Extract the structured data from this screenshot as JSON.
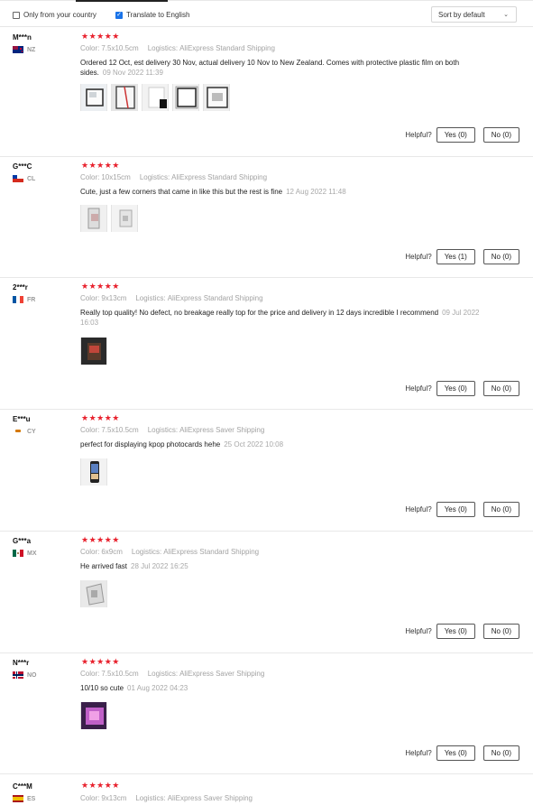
{
  "filters": {
    "only_country": {
      "label": "Only from your country",
      "checked": false
    },
    "translate": {
      "label": "Translate to English",
      "checked": true
    },
    "sort": {
      "value": "Sort by default"
    }
  },
  "labels": {
    "color_key": "Color:",
    "logistics_key": "Logistics:",
    "helpful": "Helpful?",
    "stars": "★★★★★"
  },
  "reviews": [
    {
      "user": "M***n",
      "country": "NZ",
      "color": "7.5x10.5cm",
      "logistics": "AliExpress Standard Shipping",
      "text": "Ordered 12 Oct, est delivery 30 Nov, actual delivery 10 Nov to New Zealand. Comes with protective plastic film on both sides.",
      "date": "09 Nov 2022 11:39",
      "yes": "Yes (0)",
      "no": "No (0)",
      "rating": 5,
      "images": 5
    },
    {
      "user": "G***C",
      "country": "CL",
      "color": "10x15cm",
      "logistics": "AliExpress Standard Shipping",
      "text": "Cute, just a few corners that came in like this but the rest is fine",
      "date": "12 Aug 2022 11:48",
      "yes": "Yes (1)",
      "no": "No (0)",
      "rating": 5,
      "images": 2
    },
    {
      "user": "2***r",
      "country": "FR",
      "color": "9x13cm",
      "logistics": "AliExpress Standard Shipping",
      "text": "Really top quality! No defect, no breakage really top for the price and delivery in 12 days incredible I recommend",
      "date": "09 Jul 2022 16:03",
      "yes": "Yes (0)",
      "no": "No (0)",
      "rating": 5,
      "images": 1
    },
    {
      "user": "E***u",
      "country": "CY",
      "color": "7.5x10.5cm",
      "logistics": "AliExpress Saver Shipping",
      "text": "perfect for displaying kpop photocards hehe",
      "date": "25 Oct 2022 10:08",
      "yes": "Yes (0)",
      "no": "No (0)",
      "rating": 5,
      "images": 1
    },
    {
      "user": "G***a",
      "country": "MX",
      "color": "6x9cm",
      "logistics": "AliExpress Standard Shipping",
      "text": "He arrived fast",
      "date": "28 Jul 2022 16:25",
      "yes": "Yes (0)",
      "no": "No (0)",
      "rating": 5,
      "images": 1
    },
    {
      "user": "N***r",
      "country": "NO",
      "color": "7.5x10.5cm",
      "logistics": "AliExpress Saver Shipping",
      "text": "10/10 so cute",
      "date": "01 Aug 2022 04:23",
      "yes": "Yes (0)",
      "no": "No (0)",
      "rating": 5,
      "images": 1
    },
    {
      "user": "C***M",
      "country": "ES",
      "color": "9x13cm",
      "logistics": "AliExpress Saver Shipping",
      "text": "",
      "date": "",
      "yes": "",
      "no": "",
      "rating": 5,
      "images": 0
    }
  ],
  "colors": {
    "star": "#e8212d",
    "meta_gray": "#a3a3a3",
    "checkbox_blue": "#1a73e8"
  },
  "icons": [
    "checkbox-icon",
    "chevron-down-icon",
    "star-icon",
    "flag-icon",
    "review-photo-icon"
  ]
}
